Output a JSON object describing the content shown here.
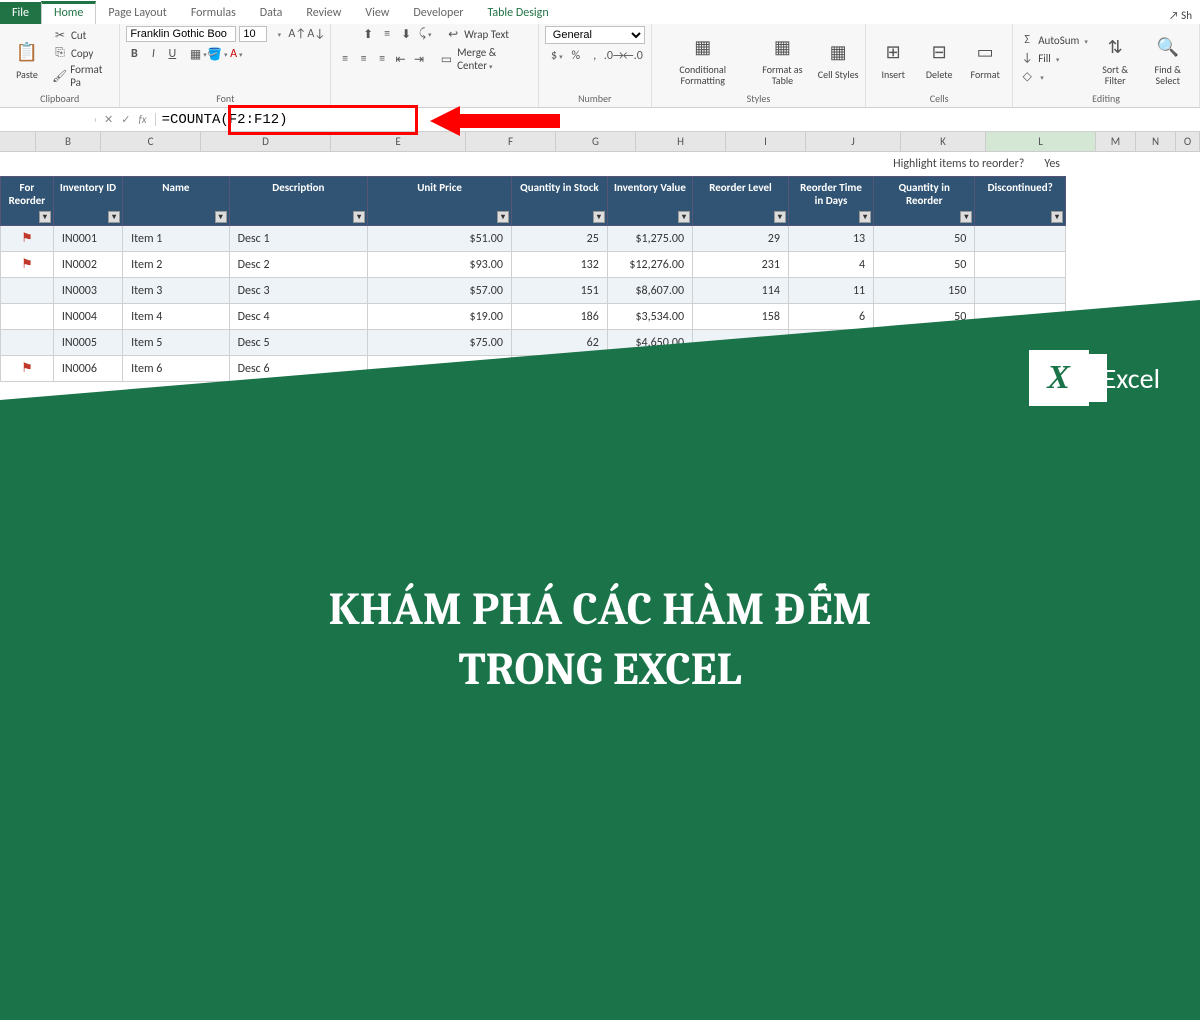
{
  "tabs": {
    "file": "File",
    "home": "Home",
    "page_layout": "Page Layout",
    "formulas": "Formulas",
    "data": "Data",
    "review": "Review",
    "view": "View",
    "developer": "Developer",
    "table_design": "Table Design",
    "share": "Sh"
  },
  "ribbon": {
    "clipboard": {
      "label": "Clipboard",
      "cut": "Cut",
      "copy": "Copy",
      "format_painter": "Format Pa"
    },
    "font": {
      "label": "Font",
      "name": "Franklin Gothic Boo",
      "size": "10",
      "bold": "B",
      "italic": "I",
      "underline": "U"
    },
    "alignment": {
      "wrap": "Wrap Text",
      "merge": "Merge & Center"
    },
    "number": {
      "label": "Number",
      "format": "General"
    },
    "styles": {
      "label": "Styles",
      "cond": "Conditional Formatting",
      "fmt_table": "Format as Table",
      "cell_styles": "Cell Styles"
    },
    "cells": {
      "label": "Cells",
      "insert": "Insert",
      "delete": "Delete",
      "format": "Format"
    },
    "editing": {
      "label": "Editing",
      "autosum": "AutoSum",
      "fill": "Fill",
      "clear": "",
      "sort": "Sort & Filter",
      "find": "Find & Select"
    }
  },
  "formula_bar": {
    "fx": "fx",
    "formula": "=COUNTA(F2:F12)"
  },
  "columns": [
    "",
    "B",
    "C",
    "D",
    "E",
    "F",
    "G",
    "H",
    "I",
    "J",
    "K",
    "L",
    "M",
    "N",
    "O"
  ],
  "highlight_row": {
    "question": "Highlight items to reorder?",
    "answer": "Yes"
  },
  "table": {
    "headers": [
      "For Reorder",
      "Inventory ID",
      "Name",
      "Description",
      "Unit Price",
      "Quantity in Stock",
      "Inventory Value",
      "Reorder Level",
      "Reorder Time in Days",
      "Quantity in Reorder",
      "Discontinued?"
    ],
    "rows": [
      {
        "flag": true,
        "id": "IN0001",
        "name": "Item 1",
        "desc": "Desc 1",
        "price": "$51.00",
        "qty": "25",
        "val": "$1,275.00",
        "rlvl": "29",
        "rdays": "13",
        "rqty": "50",
        "disc": ""
      },
      {
        "flag": true,
        "id": "IN0002",
        "name": "Item 2",
        "desc": "Desc 2",
        "price": "$93.00",
        "qty": "132",
        "val": "$12,276.00",
        "rlvl": "231",
        "rdays": "4",
        "rqty": "50",
        "disc": ""
      },
      {
        "flag": false,
        "id": "IN0003",
        "name": "Item 3",
        "desc": "Desc 3",
        "price": "$57.00",
        "qty": "151",
        "val": "$8,607.00",
        "rlvl": "114",
        "rdays": "11",
        "rqty": "150",
        "disc": ""
      },
      {
        "flag": false,
        "id": "IN0004",
        "name": "Item 4",
        "desc": "Desc 4",
        "price": "$19.00",
        "qty": "186",
        "val": "$3,534.00",
        "rlvl": "158",
        "rdays": "6",
        "rqty": "50",
        "disc": ""
      },
      {
        "flag": false,
        "id": "IN0005",
        "name": "Item 5",
        "desc": "Desc 5",
        "price": "$75.00",
        "qty": "62",
        "val": "$4,650.00",
        "rlvl": "",
        "rdays": "",
        "rqty": "",
        "disc": ""
      },
      {
        "flag": true,
        "id": "IN0006",
        "name": "Item 6",
        "desc": "Desc 6",
        "price": "",
        "qty": "",
        "val": "",
        "rlvl": "",
        "rdays": "",
        "rqty": "",
        "disc": ""
      }
    ]
  },
  "overlay": {
    "logo_text": "Excel",
    "logo_x": "X",
    "headline_l1": "KHÁM PHÁ CÁC HÀM ĐẾM",
    "headline_l2": "TRONG EXCEL"
  }
}
